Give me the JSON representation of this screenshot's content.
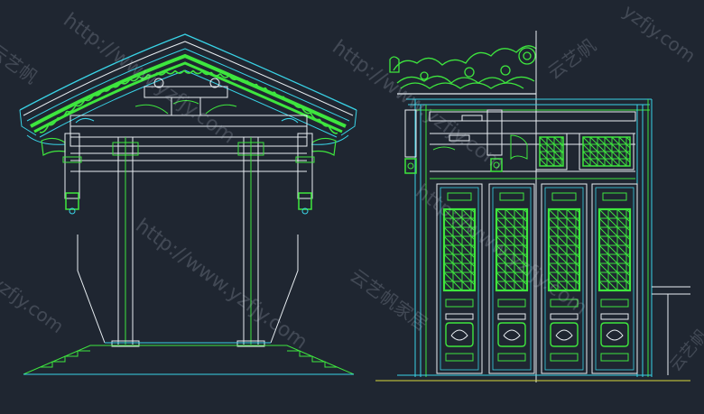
{
  "drawing": {
    "colors": {
      "background": "#1f2631",
      "green": "#3ee63e",
      "cyan": "#39d3e6",
      "white": "#e8eef2",
      "yellow": "#d8d83a",
      "gray": "#8a94a0"
    }
  },
  "watermarks": {
    "url": "http://www.yzfjy.com",
    "url_short": "yzfjy.com",
    "brand": "云艺帆",
    "brand_full": "云艺帆家居"
  }
}
